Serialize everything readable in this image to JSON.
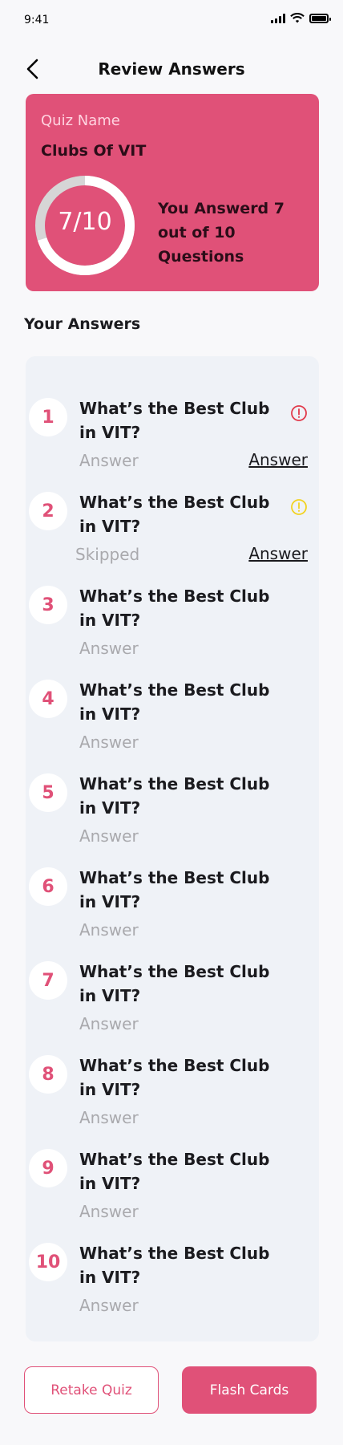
{
  "status": {
    "time": "9:41"
  },
  "header": {
    "title": "Review Answers"
  },
  "quiz": {
    "label": "Quiz Name",
    "name": "Clubs Of VIT",
    "score_text": "7/10",
    "score_fraction": 0.7,
    "summary": "You Answerd 7 out of 10 Questions"
  },
  "section_title": "Your Answers",
  "questions": [
    {
      "number": "1",
      "text": "What’s the Best Club in VIT?",
      "answer": "Answer",
      "link": "Answer",
      "status_icon": "error-icon",
      "status_color": "#e13a4b"
    },
    {
      "number": "2",
      "text": "What’s the Best Club in VIT?",
      "answer": "Skipped",
      "link": "Answer",
      "status_icon": "warning-icon",
      "status_color": "#f2d322"
    },
    {
      "number": "3",
      "text": "What’s the Best Club in VIT?",
      "answer": "Answer"
    },
    {
      "number": "4",
      "text": "What’s the Best Club in VIT?",
      "answer": "Answer"
    },
    {
      "number": "5",
      "text": "What’s the Best Club in VIT?",
      "answer": "Answer"
    },
    {
      "number": "6",
      "text": "What’s the Best Club in VIT?",
      "answer": "Answer"
    },
    {
      "number": "7",
      "text": "What’s the Best Club in VIT?",
      "answer": "Answer"
    },
    {
      "number": "8",
      "text": "What’s the Best Club in VIT?",
      "answer": "Answer"
    },
    {
      "number": "9",
      "text": "What’s the Best Club in VIT?",
      "answer": "Answer"
    },
    {
      "number": "10",
      "text": "What’s the Best Club in VIT?",
      "answer": "Answer"
    }
  ],
  "buttons": {
    "retake": "Retake Quiz",
    "flash": "Flash Cards"
  },
  "colors": {
    "accent": "#e05178",
    "panel": "#eff2f7"
  }
}
